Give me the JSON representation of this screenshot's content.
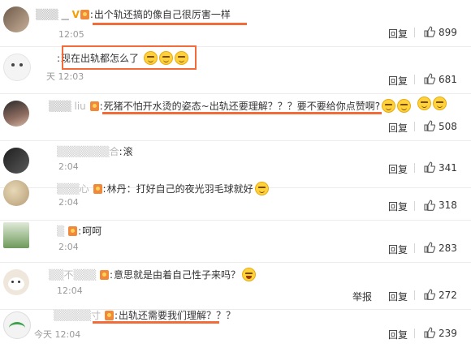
{
  "comments": [
    {
      "user": "",
      "verified": "V",
      "text": "出个轨还搞的像自己很厉害一样",
      "emoji_count": 0,
      "time": "12:05",
      "reply": "回复",
      "likes": "899"
    },
    {
      "user": "",
      "verified": "",
      "text": "现在出轨都怎么了",
      "emoji_count": 3,
      "time": "天 12:03",
      "reply": "回复",
      "likes": "681"
    },
    {
      "user": "liu",
      "verified": "",
      "text": "死猪不怕开水烫的姿态~出轨还要理解？？？要不要给你点赞啊?",
      "emoji_count": 4,
      "time": "",
      "reply": "回复",
      "likes": "508"
    },
    {
      "user": "合",
      "verified": "",
      "text": "滚",
      "emoji_count": 0,
      "time": "2:04",
      "reply": "回复",
      "likes": "341"
    },
    {
      "user": "心",
      "verified": "",
      "text": "林丹：打好自己的夜光羽毛球就好",
      "emoji_count": 1,
      "time": "2:04",
      "reply": "回复",
      "likes": "318"
    },
    {
      "user": "",
      "verified": "",
      "text": "呵呵",
      "emoji_count": 0,
      "time": "2:04",
      "reply": "回复",
      "likes": "283"
    },
    {
      "user": "不",
      "verified": "",
      "text": "意思就是由着自己性子来吗？",
      "emoji_count": 1,
      "time": "12:04",
      "reply": "回复",
      "report": "举报",
      "likes": "272"
    },
    {
      "user": "寸",
      "verified": "",
      "text": "出轨还需要我们理解？？？",
      "emoji_count": 0,
      "time": "今天 12:04",
      "reply": "回复",
      "likes": "239"
    }
  ],
  "colors": {
    "highlight": "#f26b3a",
    "emoji": "#ffd23c"
  }
}
